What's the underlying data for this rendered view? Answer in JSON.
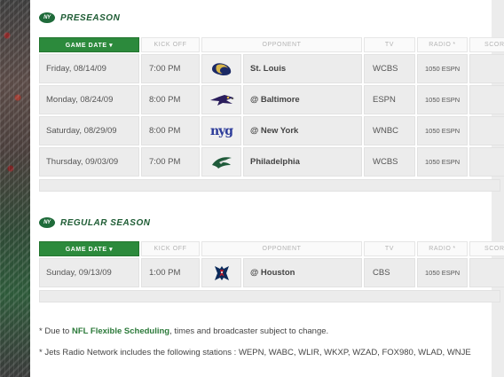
{
  "colors": {
    "accent": "#2c8a3c",
    "brand": "#1e5c34",
    "row_bg": "#ececec"
  },
  "preseason": {
    "logo_text": "NY",
    "title": "PRESEASON",
    "headers": {
      "game_date": "GAME DATE ▾",
      "kick_off": "KICK OFF",
      "opponent": "OPPONENT",
      "tv": "TV",
      "radio": "RADIO",
      "radio_mark": "*",
      "score": "SCORE"
    },
    "rows": [
      {
        "date": "Friday, 08/14/09",
        "kick_off": "7:00 PM",
        "team_icon": "rams-icon",
        "opponent": "St. Louis",
        "tv": "WCBS",
        "radio": "1050 ESPN"
      },
      {
        "date": "Monday, 08/24/09",
        "kick_off": "8:00 PM",
        "team_icon": "ravens-icon",
        "opponent": "@ Baltimore",
        "tv": "ESPN",
        "radio": "1050 ESPN"
      },
      {
        "date": "Saturday, 08/29/09",
        "kick_off": "8:00 PM",
        "team_icon": "giants-icon",
        "team_icon_text": "nyg",
        "opponent": "@ New York",
        "tv": "WNBC",
        "radio": "1050 ESPN"
      },
      {
        "date": "Thursday, 09/03/09",
        "kick_off": "7:00 PM",
        "team_icon": "eagles-icon",
        "opponent": "Philadelphia",
        "tv": "WCBS",
        "radio": "1050 ESPN"
      }
    ]
  },
  "regular_season": {
    "logo_text": "NY",
    "title": "REGULAR SEASON",
    "headers": {
      "game_date": "GAME DATE ▾",
      "kick_off": "KICK OFF",
      "opponent": "OPPONENT",
      "tv": "TV",
      "radio": "RADIO",
      "radio_mark": "*",
      "score": "SCORE"
    },
    "rows": [
      {
        "date": "Sunday, 09/13/09",
        "kick_off": "1:00 PM",
        "team_icon": "texans-icon",
        "opponent": "@ Houston",
        "tv": "CBS",
        "radio": "1050 ESPN"
      }
    ]
  },
  "notes": {
    "flex_prefix": "* Due to ",
    "flex_link": "NFL Flexible Scheduling",
    "flex_suffix": ", times and broadcaster subject to change.",
    "radio_network": "* Jets Radio Network includes the following stations : WEPN, WABC, WLIR, WKXP, WZAD, FOX980, WLAD, WNJE"
  }
}
